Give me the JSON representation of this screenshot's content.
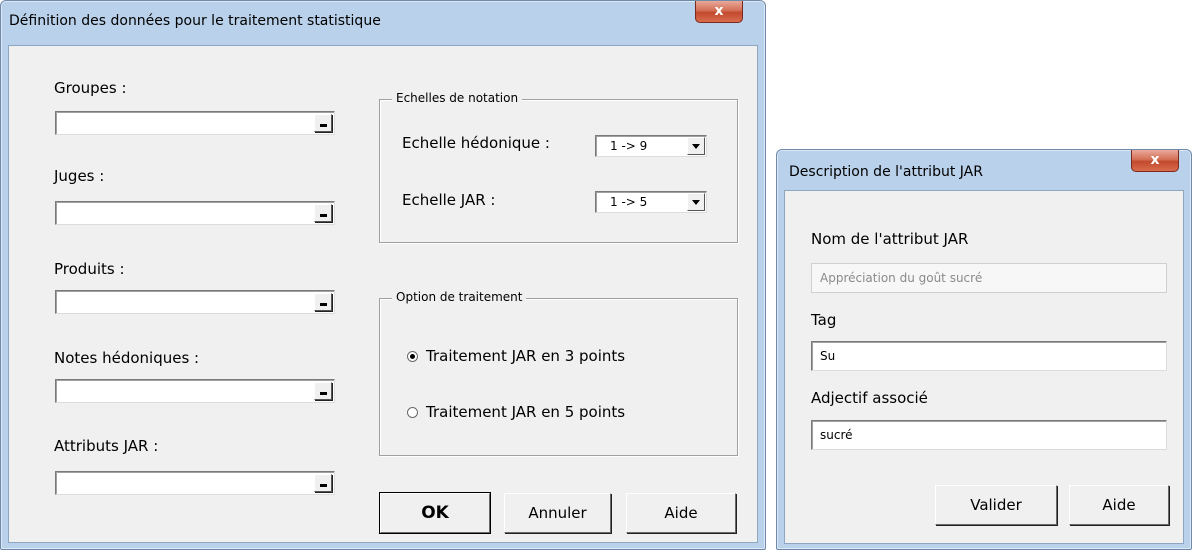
{
  "dialog1": {
    "title": "Définition des données pour le traitement statistique",
    "close_label": "x",
    "fields": [
      {
        "label": "Groupes :",
        "value": ""
      },
      {
        "label": "Juges  :",
        "value": ""
      },
      {
        "label": "Produits :",
        "value": ""
      },
      {
        "label": "Notes hédoniques :",
        "value": ""
      },
      {
        "label": "Attributs JAR  :",
        "value": ""
      }
    ],
    "scales_group": {
      "title": "Echelles de notation",
      "hedonic_label": "Echelle hédonique :",
      "hedonic_value": "1 -> 9",
      "jar_label": "Echelle JAR :",
      "jar_value": "1 -> 5"
    },
    "option_group": {
      "title": "Option de traitement",
      "option_3": "Traitement JAR en 3 points",
      "option_5": "Traitement JAR en 5 points",
      "selected": "option_3"
    },
    "buttons": {
      "ok": "OK",
      "cancel": "Annuler",
      "help": "Aide"
    }
  },
  "dialog2": {
    "title": "Description de l'attribut JAR",
    "close_label": "x",
    "name_label": "Nom de l'attribut JAR",
    "name_placeholder": "Appréciation du goût sucré",
    "tag_label": "Tag",
    "tag_value": "Su",
    "adjective_label": "Adjectif associé",
    "adjective_value": "sucré",
    "buttons": {
      "validate": "Valider",
      "help": "Aide"
    }
  }
}
